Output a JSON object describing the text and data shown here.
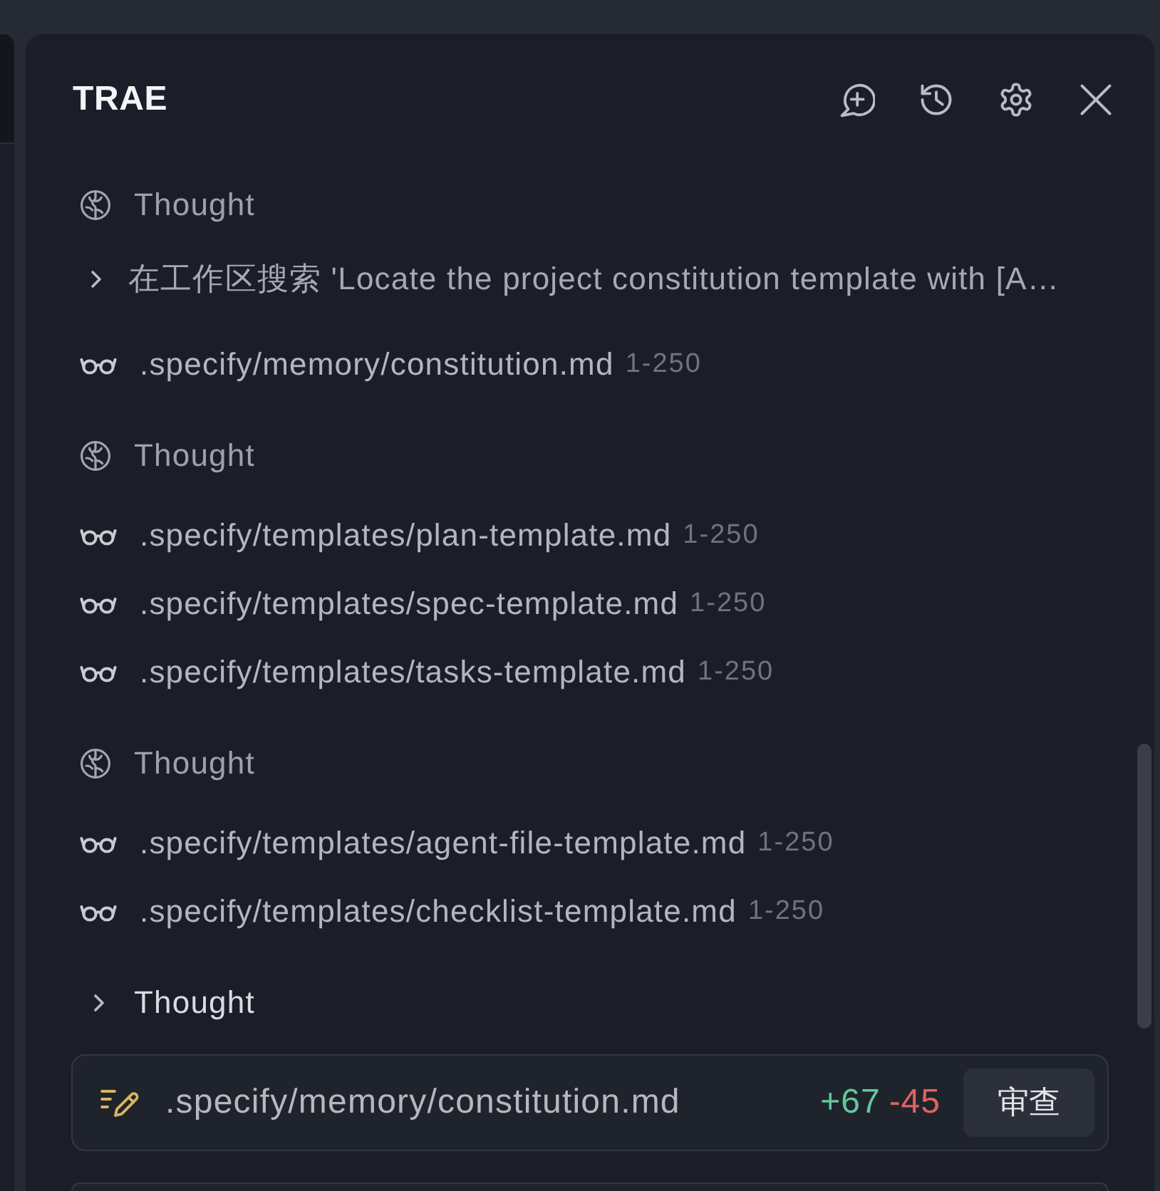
{
  "panel": {
    "title": "TRAE"
  },
  "steps": [
    {
      "kind": "thought",
      "label": "Thought"
    },
    {
      "kind": "search",
      "label": "在工作区搜索 'Locate the project constitution template with [A…",
      "expanded": false
    },
    {
      "kind": "read",
      "path": ".specify/memory/constitution.md",
      "range": "1-250"
    },
    {
      "kind": "thought",
      "label": "Thought"
    },
    {
      "kind": "read",
      "path": ".specify/templates/plan-template.md",
      "range": "1-250"
    },
    {
      "kind": "read",
      "path": ".specify/templates/spec-template.md",
      "range": "1-250"
    },
    {
      "kind": "read",
      "path": ".specify/templates/tasks-template.md",
      "range": "1-250"
    },
    {
      "kind": "thought",
      "label": "Thought"
    },
    {
      "kind": "read",
      "path": ".specify/templates/agent-file-template.md",
      "range": "1-250"
    },
    {
      "kind": "read",
      "path": ".specify/templates/checklist-template.md",
      "range": "1-250"
    },
    {
      "kind": "toggle",
      "label": "Thought",
      "expanded": false
    }
  ],
  "change": {
    "path": ".specify/memory/constitution.md",
    "additions": "+67",
    "deletions": "-45",
    "button": "审查"
  }
}
